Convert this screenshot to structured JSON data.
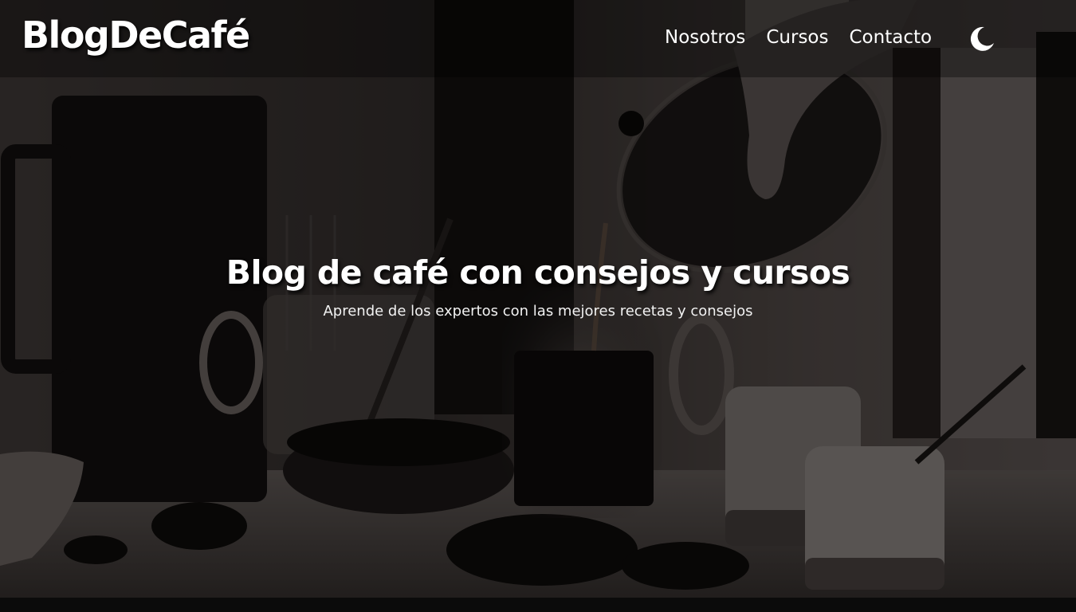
{
  "header": {
    "logo": "BlogDeCafé",
    "nav": [
      {
        "label": "Nosotros"
      },
      {
        "label": "Cursos"
      },
      {
        "label": "Contacto"
      }
    ],
    "theme_toggle_icon": "moon-icon"
  },
  "hero": {
    "title": "Blog de café con consejos y cursos",
    "subtitle": "Aprende de los expertos con las mejores recetas y consejos",
    "background_image": "coffee-pour-photo"
  },
  "colors": {
    "text": "#ffffff",
    "overlay": "#000000"
  }
}
